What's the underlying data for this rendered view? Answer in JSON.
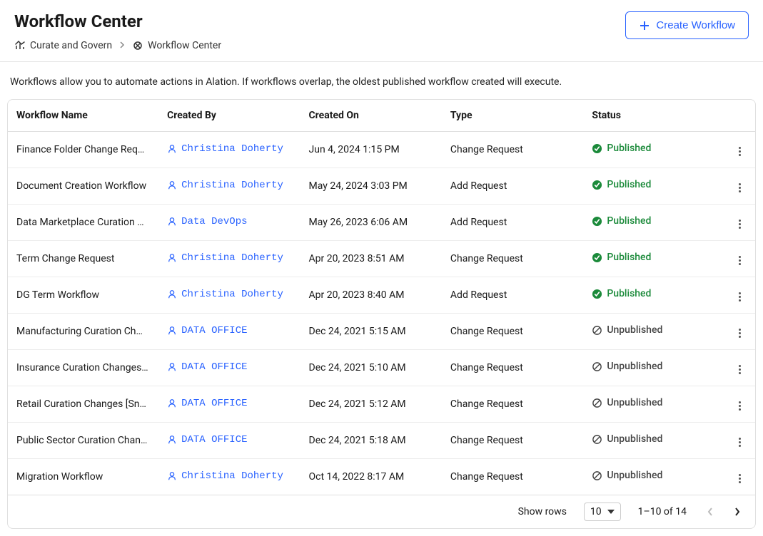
{
  "header": {
    "title": "Workflow Center",
    "create_label": "Create Workflow"
  },
  "breadcrumb": {
    "root": "Curate and Govern",
    "current": "Workflow Center"
  },
  "description": "Workflows allow you to automate actions in Alation. If workflows overlap, the oldest published workflow created will execute.",
  "columns": {
    "name": "Workflow Name",
    "created_by": "Created By",
    "created_on": "Created On",
    "type": "Type",
    "status": "Status"
  },
  "status_labels": {
    "published": "Published",
    "unpublished": "Unpublished"
  },
  "rows": [
    {
      "name": "Finance Folder Change Req…",
      "created_by": "Christina Doherty",
      "created_on": "Jun 4, 2024 1:15 PM",
      "type": "Change Request",
      "status": "published"
    },
    {
      "name": "Document Creation Workflow",
      "created_by": "Christina Doherty",
      "created_on": "May 24, 2024 3:03 PM",
      "type": "Add Request",
      "status": "published"
    },
    {
      "name": "Data Marketplace Curation …",
      "created_by": "Data DevOps",
      "created_on": "May 26, 2023 6:06 AM",
      "type": "Add Request",
      "status": "published"
    },
    {
      "name": "Term Change Request",
      "created_by": "Christina Doherty",
      "created_on": "Apr 20, 2023 8:51 AM",
      "type": "Change Request",
      "status": "published"
    },
    {
      "name": "DG Term Workflow",
      "created_by": "Christina Doherty",
      "created_on": "Apr 20, 2023 8:40 AM",
      "type": "Add Request",
      "status": "published"
    },
    {
      "name": "Manufacturing Curation Ch…",
      "created_by": "DATA OFFICE",
      "created_on": "Dec 24, 2021 5:15 AM",
      "type": "Change Request",
      "status": "unpublished"
    },
    {
      "name": "Insurance Curation Changes…",
      "created_by": "DATA OFFICE",
      "created_on": "Dec 24, 2021 5:10 AM",
      "type": "Change Request",
      "status": "unpublished"
    },
    {
      "name": "Retail Curation Changes [Sn…",
      "created_by": "DATA OFFICE",
      "created_on": "Dec 24, 2021 5:12 AM",
      "type": "Change Request",
      "status": "unpublished"
    },
    {
      "name": "Public Sector Curation Chan…",
      "created_by": "DATA OFFICE",
      "created_on": "Dec 24, 2021 5:18 AM",
      "type": "Change Request",
      "status": "unpublished"
    },
    {
      "name": "Migration Workflow",
      "created_by": "Christina Doherty",
      "created_on": "Oct 14, 2022 8:17 AM",
      "type": "Change Request",
      "status": "unpublished"
    }
  ],
  "footer": {
    "show_rows_label": "Show rows",
    "rows_value": "10",
    "range": "1–10 of 14"
  }
}
